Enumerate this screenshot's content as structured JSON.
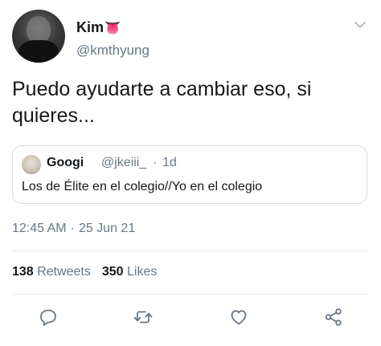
{
  "author": {
    "display_name": "Kim",
    "emoji": "👅",
    "handle": "@kmthyung"
  },
  "tweet": {
    "text": "Puedo ayudarte a cambiar eso, si quieres..."
  },
  "quoted": {
    "name": "Googi",
    "handle": "@jkeiii_",
    "separator": "·",
    "time": "1d",
    "text": "Los de Élite en el colegio//Yo en el colegio"
  },
  "meta": {
    "time": "12:45 AM",
    "separator": "·",
    "date": "25 Jun 21"
  },
  "stats": {
    "retweets_count": "138",
    "retweets_label": "Retweets",
    "likes_count": "350",
    "likes_label": "Likes"
  },
  "icons": {
    "chevron": "chevron-down-icon",
    "reply": "reply-icon",
    "retweet": "retweet-icon",
    "like": "heart-icon",
    "share": "share-icon"
  },
  "colors": {
    "text_primary": "#14171a",
    "text_secondary": "#657786",
    "border": "#d6dde3"
  }
}
